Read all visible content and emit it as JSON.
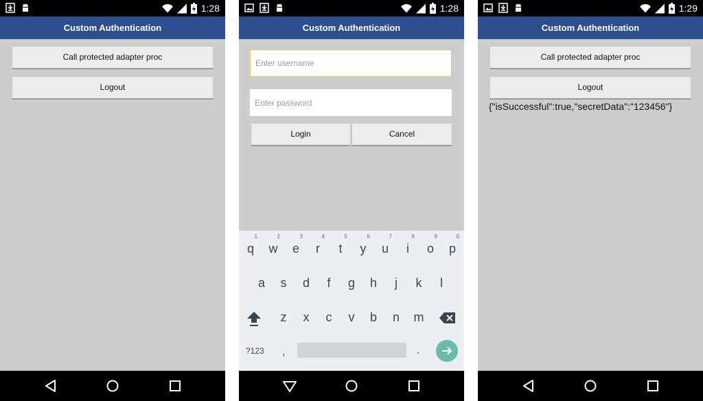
{
  "status_time": [
    "1:28",
    "1:28",
    "1:29"
  ],
  "app_title": "Custom Authentication",
  "screen1": {
    "call_btn": "Call protected adapter proc",
    "logout_btn": "Logout"
  },
  "screen2": {
    "username_placeholder": "Enter username",
    "password_placeholder": "Enter password",
    "login_btn": "Login",
    "cancel_btn": "Cancel"
  },
  "screen3": {
    "call_btn": "Call protected adapter proc",
    "logout_btn": "Logout",
    "result": "{\"isSuccessful\":true,\"secretData\":\"123456\"}"
  },
  "keyboard": {
    "row1": [
      "q",
      "w",
      "e",
      "r",
      "t",
      "y",
      "u",
      "i",
      "o",
      "p"
    ],
    "row1_hints": [
      "1",
      "2",
      "3",
      "4",
      "5",
      "6",
      "7",
      "8",
      "9",
      "0"
    ],
    "row2": [
      "a",
      "s",
      "d",
      "f",
      "g",
      "h",
      "j",
      "k",
      "l"
    ],
    "row3": [
      "z",
      "x",
      "c",
      "v",
      "b",
      "n",
      "m"
    ],
    "symbols_key": "?123",
    "comma_key": ",",
    "period_key": "."
  },
  "colors": {
    "appbar": "#2d4f8f",
    "accent_focus": "#e2c76a",
    "enter_key": "#6bbbad"
  }
}
